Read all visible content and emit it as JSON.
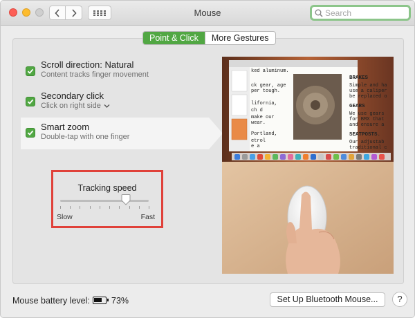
{
  "window": {
    "title": "Mouse",
    "search_placeholder": "Search"
  },
  "tabs": [
    {
      "label": "Point & Click",
      "active": true
    },
    {
      "label": "More Gestures",
      "active": false
    }
  ],
  "options": [
    {
      "title": "Scroll direction: Natural",
      "subtitle": "Content tracks finger movement",
      "checked": true
    },
    {
      "title": "Secondary click",
      "subtitle": "Click on right side",
      "checked": true
    },
    {
      "title": "Smart zoom",
      "subtitle": "Double-tap with one finger",
      "checked": true,
      "selected": true
    }
  ],
  "tracking": {
    "title": "Tracking speed",
    "min_label": "Slow",
    "max_label": "Fast",
    "value_fraction": 0.74
  },
  "preview": {
    "doc_lines_left": [
      "ked aluminum.",
      "ck gear, age",
      "per tough.",
      "lifornia,",
      "ch d",
      "make our",
      "wear.",
      "Portland,",
      "etrol",
      "e a"
    ],
    "doc_heading_1": "BRAKES",
    "doc_body_1": [
      "Simple and ha",
      "use a caliper",
      "be replaced o"
    ],
    "doc_heading_2": "GEARS",
    "doc_body_2": [
      "We use gears",
      "for BMX that",
      "and ensure a"
    ],
    "doc_heading_3": "SEATPOSTS.",
    "doc_body_3": [
      "Our adjustab",
      "traditional c"
    ]
  },
  "footer": {
    "battery_label": "Mouse battery level:",
    "battery_percent": "73%",
    "battery_level": 0.73,
    "bluetooth_button": "Set Up Bluetooth Mouse...",
    "help_label": "?"
  },
  "colors": {
    "accent": "#51a743",
    "highlight_box": "#e0413a"
  }
}
